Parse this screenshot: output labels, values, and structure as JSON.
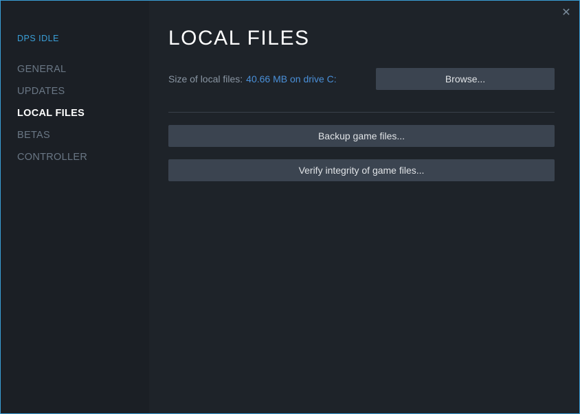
{
  "close_icon": "✕",
  "sidebar": {
    "app_name": "DPS IDLE",
    "items": [
      {
        "label": "GENERAL",
        "active": false
      },
      {
        "label": "UPDATES",
        "active": false
      },
      {
        "label": "LOCAL FILES",
        "active": true
      },
      {
        "label": "BETAS",
        "active": false
      },
      {
        "label": "CONTROLLER",
        "active": false
      }
    ]
  },
  "content": {
    "title": "LOCAL FILES",
    "size_label": "Size of local files:",
    "size_value": "40.66 MB on drive C:",
    "browse_btn": "Browse...",
    "backup_btn": "Backup game files...",
    "verify_btn": "Verify integrity of game files..."
  }
}
